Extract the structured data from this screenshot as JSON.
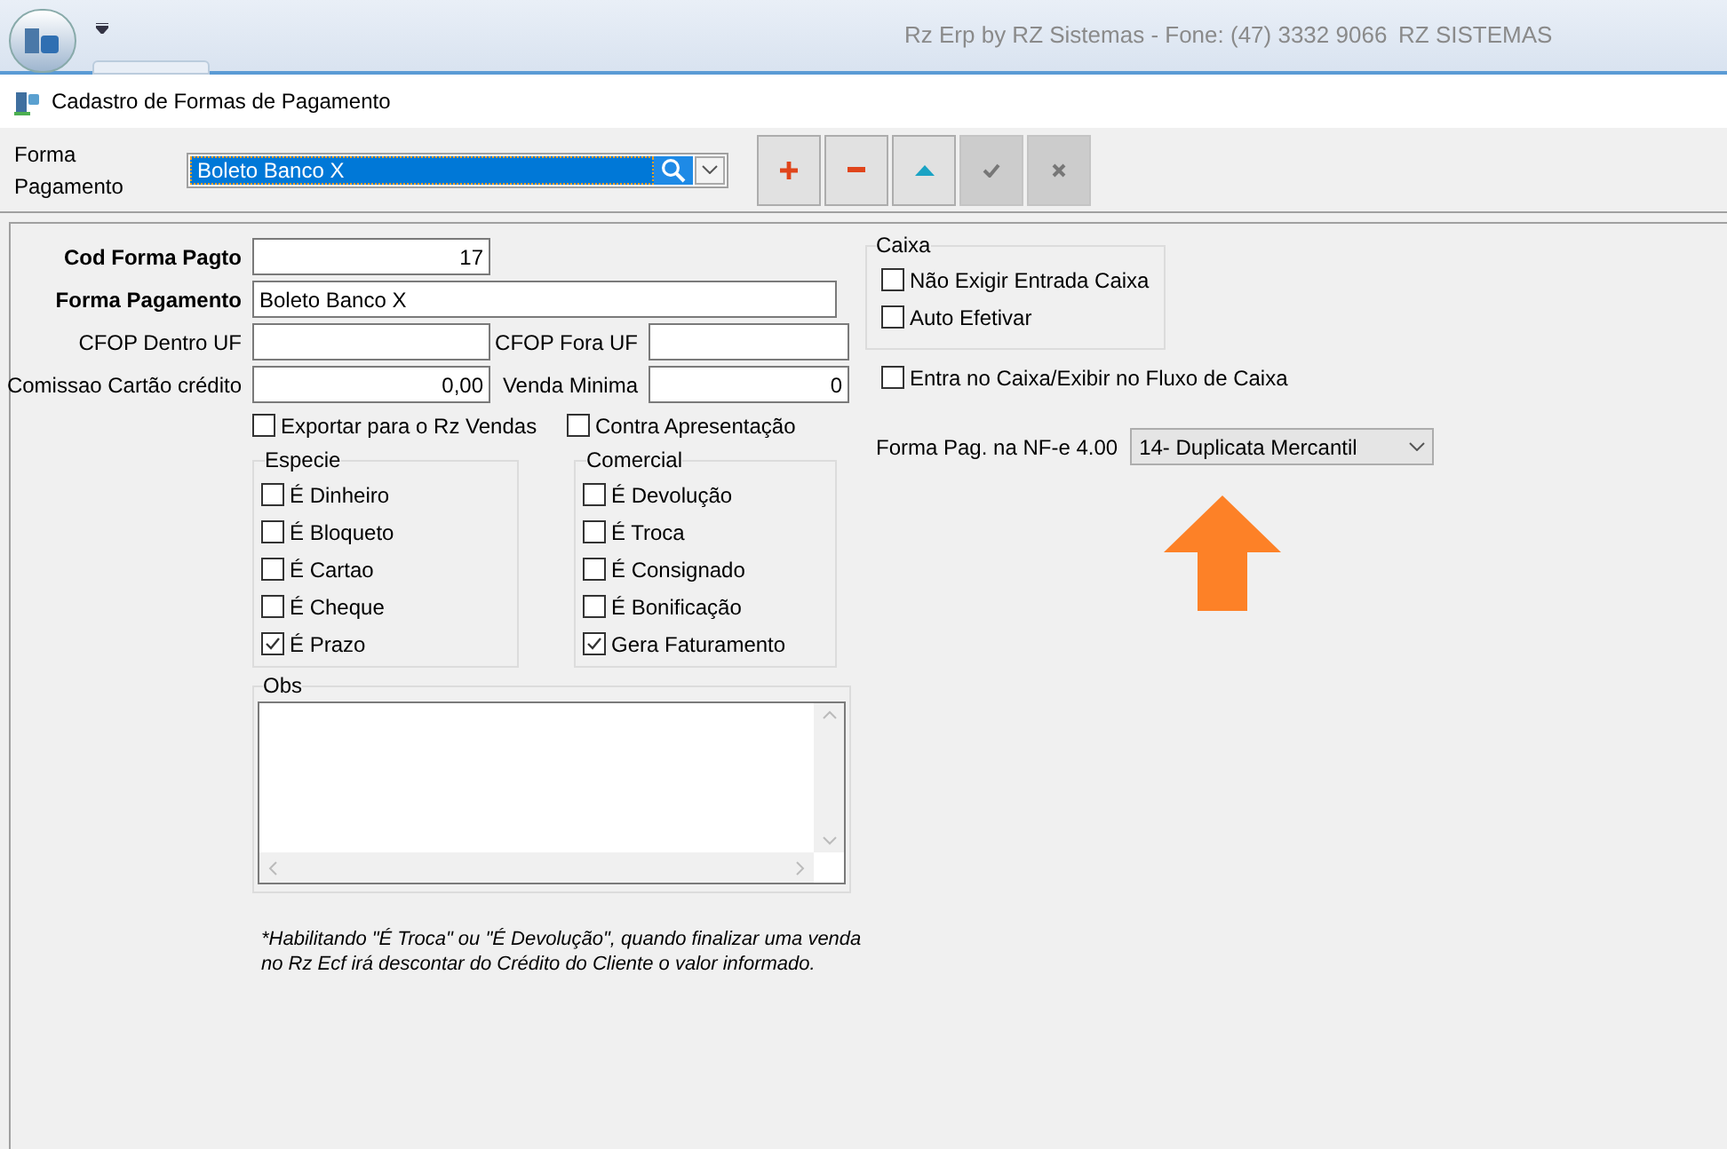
{
  "app_bar": {
    "title": "Rz Erp by RZ Sistemas - Fone: (47) 3332 9066",
    "company": "RZ SISTEMAS"
  },
  "window": {
    "title": "Cadastro de Formas de Pagamento"
  },
  "toolbar": {
    "label": "Forma Pagamento",
    "selector_value": "Boleto Banco X",
    "buttons": [
      {
        "kind": "add",
        "disabled": false
      },
      {
        "kind": "remove",
        "disabled": false
      },
      {
        "kind": "up",
        "disabled": false
      },
      {
        "kind": "confirm",
        "disabled": true
      },
      {
        "kind": "cancel",
        "disabled": true
      }
    ]
  },
  "form": {
    "cod": {
      "label": "Cod Forma Pagto",
      "value": "17"
    },
    "forma": {
      "label": "Forma Pagamento",
      "value": "Boleto Banco X"
    },
    "cfop_dentro": {
      "label": "CFOP Dentro UF"
    },
    "cfop_fora": {
      "label": "CFOP Fora UF"
    },
    "comissao": {
      "label": "Comissao Cartão crédito",
      "value": "0,00"
    },
    "venda_minima": {
      "label": "Venda Minima",
      "value": "0"
    },
    "options": [
      {
        "label": "Exportar para o Rz Vendas",
        "checked": false
      },
      {
        "label": "Contra Apresentação",
        "checked": false
      }
    ],
    "especie": {
      "title": "Especie",
      "items": [
        {
          "label": "É Dinheiro",
          "checked": false
        },
        {
          "label": "É Bloqueto",
          "checked": false
        },
        {
          "label": "É Cartao",
          "checked": false
        },
        {
          "label": "É Cheque",
          "checked": false
        },
        {
          "label": "É Prazo",
          "checked": true
        }
      ]
    },
    "comercial": {
      "title": "Comercial",
      "items": [
        {
          "label": "É Devolução",
          "checked": false
        },
        {
          "label": "É Troca",
          "checked": false
        },
        {
          "label": "É Consignado",
          "checked": false
        },
        {
          "label": "É Bonificação",
          "checked": false
        },
        {
          "label": "Gera Faturamento",
          "checked": true
        }
      ]
    },
    "obs": {
      "label": "Obs"
    },
    "note": "*Habilitando \"É Troca\" ou \"É Devolução\", quando finalizar uma venda no Rz Ecf irá descontar do Crédito do Cliente o valor informado.",
    "caixa": {
      "title": "Caixa",
      "items": [
        {
          "label": "Não Exigir Entrada Caixa",
          "checked": false
        },
        {
          "label": "Auto Efetivar",
          "checked": false
        }
      ]
    },
    "fluxo": {
      "label": "Entra no Caixa/Exibir no Fluxo de Caixa",
      "checked": false
    },
    "nfe": {
      "label": "Forma Pag. na NF-e 4.00",
      "value": "14- Duplicata Mercantil"
    }
  }
}
